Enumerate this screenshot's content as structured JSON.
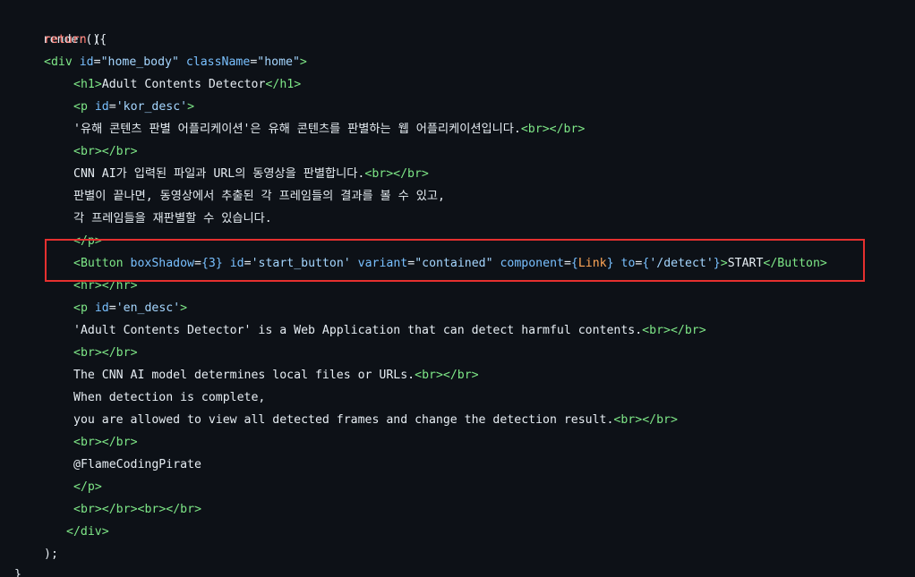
{
  "code": {
    "l1": "render(){",
    "l2_kw": "return",
    "l2_paren": " (",
    "l3": {
      "open": "<",
      "tag": "div",
      "attr1": " id",
      "eq1": "=",
      "val1": "\"home_body\"",
      "attr2": " className",
      "eq2": "=",
      "val2": "\"home\"",
      "close": ">"
    },
    "l4": {
      "open": "<",
      "tag": "h1",
      "gt": ">",
      "text": "Adult Contents Detector",
      "close_open": "</",
      "close_tag": "h1",
      "close_gt": ">"
    },
    "l5": {
      "open": "<",
      "tag": "p",
      "attr": " id",
      "eq": "=",
      "val": "'kor_desc'",
      "gt": ">"
    },
    "l6": {
      "text": "'유해 콘텐츠 판별 어플리케이션'은 유해 콘텐츠를 판별하는 웹 어플리케이션입니다.",
      "br_open": "<",
      "br": "br",
      "br_mid": "></",
      "br2": "br",
      "br_close": ">"
    },
    "l7": {
      "o": "<",
      "t": "br",
      "m": "></",
      "t2": "br",
      "c": ">"
    },
    "l8": {
      "text": "CNN AI가 입력된 파일과 URL의 동영상을 판별합니다.",
      "o": "<",
      "t": "br",
      "m": "></",
      "t2": "br",
      "c": ">"
    },
    "l9": "판별이 끝나면, 동영상에서 추출된 각 프레임들의 결과를 볼 수 있고,",
    "l10": "각 프레임들을 재판별할 수 있습니다.",
    "l11": {
      "o": "</",
      "t": "p",
      "c": ">"
    },
    "l12": {
      "o": "<",
      "tag": "Button",
      "a1": " boxShadow",
      "eq1": "=",
      "b1": "{3}",
      "a2": " id",
      "eq2": "=",
      "v2": "'start_button'",
      "a3": " variant",
      "eq3": "=",
      "v3": "\"contained\"",
      "a4": " component",
      "eq4": "=",
      "b4o": "{",
      "comp": "Link",
      "b4c": "}",
      "a5": " to",
      "eq5": "=",
      "b5o": "{",
      "v5": "'/detect'",
      "b5c": "}",
      "gt": ">",
      "text": "START",
      "co": "</",
      "ctag": "Button",
      "cg": ">"
    },
    "l13": {
      "o": "<",
      "t": "hr",
      "m": "></",
      "t2": "hr",
      "c": ">"
    },
    "l14": {
      "open": "<",
      "tag": "p",
      "attr": " id",
      "eq": "=",
      "val": "'en_desc'",
      "gt": ">"
    },
    "l15": {
      "text": "'Adult Contents Detector' is a Web Application that can detect harmful contents.",
      "o": "<",
      "t": "br",
      "m": "></",
      "t2": "br",
      "c": ">"
    },
    "l16": {
      "o": "<",
      "t": "br",
      "m": "></",
      "t2": "br",
      "c": ">"
    },
    "l17": {
      "text": "The CNN AI model determines local files or URLs.",
      "o": "<",
      "t": "br",
      "m": "></",
      "t2": "br",
      "c": ">"
    },
    "l18": "When detection is complete,",
    "l19": {
      "text": "you are allowed to view all detected frames and change the detection result.",
      "o": "<",
      "t": "br",
      "m": "></",
      "t2": "br",
      "c": ">"
    },
    "l20": {
      "o": "<",
      "t": "br",
      "m": "></",
      "t2": "br",
      "c": ">"
    },
    "l21": "@FlameCodingPirate",
    "l22": {
      "o": "</",
      "t": "p",
      "c": ">"
    },
    "l23": {
      "o1": "<",
      "t1": "br",
      "m1": "></",
      "t2": "br",
      "c1": "><",
      "t3": "br",
      "m2": "></",
      "t4": "br",
      "c2": ">"
    },
    "l24": {
      "o": "</",
      "t": "div",
      "c": ">"
    },
    "l25": ");",
    "l26": "}"
  },
  "colors": {
    "background": "#0d1117",
    "tag": "#7ee787",
    "attribute": "#79c0ff",
    "string": "#a5d6ff",
    "keyword": "#ff7b72",
    "component": "#ffa657",
    "highlight_border": "#e5302f"
  }
}
